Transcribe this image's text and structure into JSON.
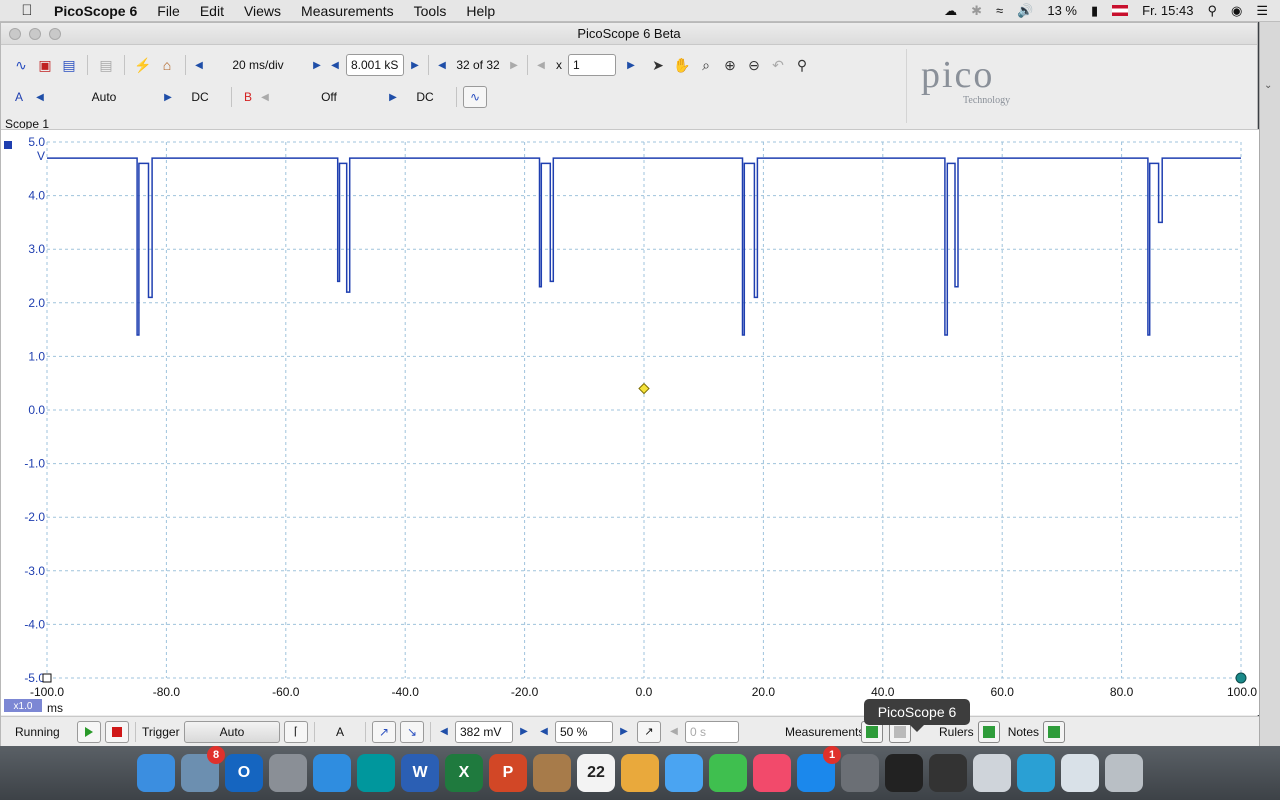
{
  "menubar": {
    "apple": "",
    "app_name": "PicoScope 6",
    "items": [
      "File",
      "Edit",
      "Views",
      "Measurements",
      "Tools",
      "Help"
    ],
    "battery": "13 %",
    "clock": "Fr. 15:43"
  },
  "window": {
    "title": "PicoScope 6 Beta"
  },
  "toolbar1": {
    "timebase": "20 ms/div",
    "samples": "8.001 kS",
    "buffer": "32 of 32",
    "zoom_label": "x",
    "zoom_value": "1"
  },
  "toolbar2": {
    "channel_a": {
      "label": "A",
      "range": "Auto",
      "coupling": "DC",
      "color": "#1f3fb0"
    },
    "channel_b": {
      "label": "B",
      "range": "Off",
      "coupling": "DC",
      "color": "#d42222"
    }
  },
  "logo": {
    "word": "pico",
    "sub": "Technology"
  },
  "scope": {
    "label": "Scope 1",
    "y_unit": "V",
    "x_unit": "ms",
    "x_zoom": "x1.0",
    "y_ticks": [
      "5.0",
      "4.0",
      "3.0",
      "2.0",
      "1.0",
      "0.0",
      "-1.0",
      "-2.0",
      "-3.0",
      "-4.0",
      "-5.0"
    ],
    "x_ticks": [
      "-100.0",
      "-80.0",
      "-60.0",
      "-40.0",
      "-20.0",
      "0.0",
      "20.0",
      "40.0",
      "60.0",
      "80.0",
      "100.0"
    ]
  },
  "chart_data": {
    "type": "line",
    "series": [
      {
        "name": "A",
        "color": "#1f3fb0",
        "x": [
          -100,
          -84.9,
          -84.9,
          -84.6,
          -84.6,
          -83,
          -83,
          -82.4,
          -82.4,
          -82.2,
          -51.3,
          -51.3,
          -51,
          -51,
          -49.8,
          -49.8,
          -49.3,
          -49.3,
          -49.1,
          -17.5,
          -17.5,
          -17.2,
          -17.2,
          -15.7,
          -15.7,
          -15.2,
          -15.2,
          -15,
          16.5,
          16.5,
          16.8,
          16.8,
          18.5,
          18.5,
          19,
          19,
          19.2,
          50.4,
          50.4,
          50.8,
          50.8,
          52.1,
          52.1,
          52.6,
          52.6,
          52.8,
          84.4,
          84.4,
          84.7,
          84.7,
          86.2,
          86.2,
          86.8,
          86.8,
          100
        ],
        "y": [
          4.7,
          4.7,
          1.4,
          1.4,
          4.6,
          4.6,
          2.1,
          2.1,
          4.7,
          4.7,
          4.7,
          2.4,
          2.4,
          4.6,
          4.6,
          2.2,
          2.2,
          4.7,
          4.7,
          4.7,
          2.3,
          2.3,
          4.6,
          4.6,
          2.4,
          2.4,
          4.7,
          4.7,
          4.7,
          1.4,
          1.4,
          4.6,
          4.6,
          2.1,
          2.1,
          4.7,
          4.7,
          4.7,
          1.4,
          1.4,
          4.6,
          4.6,
          2.3,
          2.3,
          4.7,
          4.7,
          4.7,
          1.4,
          1.4,
          4.6,
          4.6,
          3.5,
          3.5,
          4.7,
          4.7
        ]
      }
    ],
    "xlabel": "ms",
    "ylabel": "V",
    "xlim": [
      -100,
      100
    ],
    "ylim": [
      -5,
      5
    ],
    "grid": true,
    "trigger_marker": {
      "x": 0,
      "y": 0.4
    }
  },
  "status": {
    "state": "Running",
    "trigger_label": "Trigger",
    "trigger_mode": "Auto",
    "trigger_channel": "A",
    "threshold": "382 mV",
    "pretrigger": "50 %",
    "delay": "0 s",
    "measurements": "Measurements",
    "rulers": "Rulers",
    "notes": "Notes"
  },
  "tooltip": "PicoScope 6",
  "dock": {
    "apps": [
      {
        "name": "Finder",
        "color": "#3b8ee0"
      },
      {
        "name": "Bird",
        "color": "#6c8fb0",
        "badge": "8"
      },
      {
        "name": "Outlook",
        "color": "#1565c0",
        "letter": "O"
      },
      {
        "name": "Rocket",
        "color": "#8a8f96"
      },
      {
        "name": "Safari",
        "color": "#2f8de0"
      },
      {
        "name": "Arduino",
        "color": "#00979d"
      },
      {
        "name": "Word",
        "color": "#2b5fb4",
        "letter": "W"
      },
      {
        "name": "Excel",
        "color": "#1f7a3e",
        "letter": "X"
      },
      {
        "name": "PowerPoint",
        "color": "#d24726",
        "letter": "P"
      },
      {
        "name": "Contacts",
        "color": "#a77b4a"
      },
      {
        "name": "Calendar",
        "color": "#f3f3f3",
        "letter": "22"
      },
      {
        "name": "Photos",
        "color": "#e9a93c"
      },
      {
        "name": "Messages",
        "color": "#4aa4f2"
      },
      {
        "name": "FaceTime",
        "color": "#3fbf4f"
      },
      {
        "name": "Music",
        "color": "#f24a6b"
      },
      {
        "name": "AppStore",
        "color": "#1b88ec",
        "badge": "1"
      },
      {
        "name": "Preferences",
        "color": "#6b6f75"
      },
      {
        "name": "PicoScope",
        "color": "#222"
      },
      {
        "name": "PicoScope2",
        "color": "#333"
      },
      {
        "name": "Disk",
        "color": "#cfd4da"
      },
      {
        "name": "Box",
        "color": "#2aa0d4"
      },
      {
        "name": "Display",
        "color": "#d9e1e8"
      },
      {
        "name": "Trash",
        "color": "#b9bfc5"
      }
    ]
  }
}
